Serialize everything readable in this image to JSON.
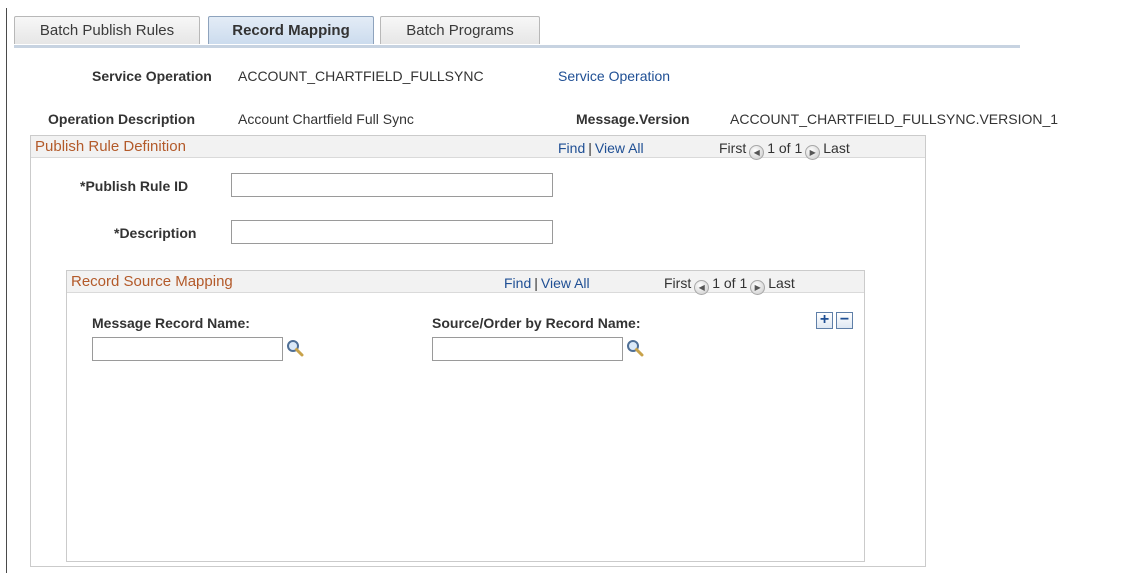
{
  "tabs": [
    {
      "label": "Batch Publish Rules",
      "active": false
    },
    {
      "label": "Record Mapping",
      "active": true
    },
    {
      "label": "Batch Programs",
      "active": false
    }
  ],
  "header": {
    "service_operation_label": "Service Operation",
    "service_operation_value": "ACCOUNT_CHARTFIELD_FULLSYNC",
    "service_operation_link": "Service Operation",
    "operation_description_label": "Operation Description",
    "operation_description_value": "Account Chartfield Full Sync",
    "message_version_label": "Message.Version",
    "message_version_value": "ACCOUNT_CHARTFIELD_FULLSYNC.VERSION_1"
  },
  "publish_rule": {
    "title": "Publish Rule Definition",
    "nav": {
      "find": "Find",
      "sep": "|",
      "view_all": "View All",
      "first": "First",
      "count": "1 of 1",
      "last": "Last"
    },
    "publish_rule_id_label": "*Publish Rule ID",
    "publish_rule_id_value": "",
    "description_label": "*Description",
    "description_value": ""
  },
  "record_source": {
    "title": "Record Source Mapping",
    "nav": {
      "find": "Find",
      "sep": "|",
      "view_all": "View All",
      "first": "First",
      "count": "1 of 1",
      "last": "Last"
    },
    "message_record_label": "Message Record Name:",
    "message_record_value": "",
    "source_order_label": "Source/Order by Record Name:",
    "source_order_value": "",
    "add_row": "+",
    "delete_row": "−"
  },
  "icons": {
    "lookup": "magnifier-icon",
    "previous": "previous-arrow-icon",
    "next": "next-arrow-icon",
    "add": "plus-icon",
    "delete": "minus-icon"
  },
  "colors": {
    "group_title": "#b35a2a",
    "link": "#1f4f94",
    "active_tab": "#ccdcee"
  }
}
